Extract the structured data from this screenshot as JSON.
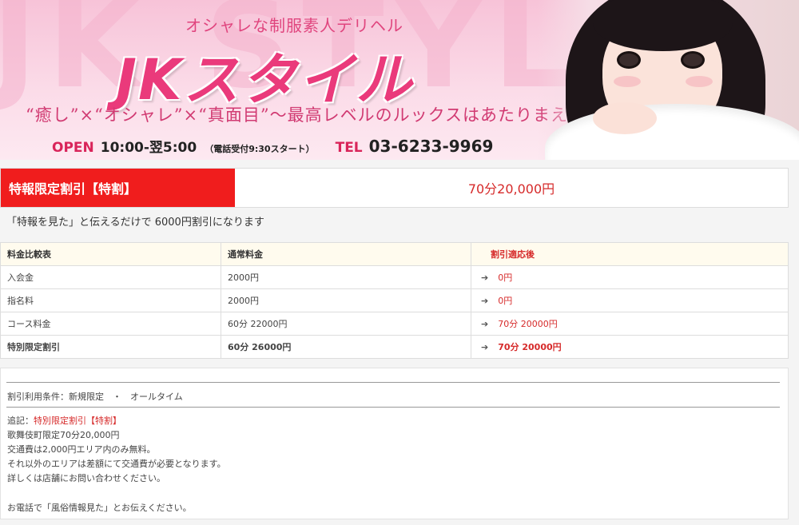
{
  "banner": {
    "bg_word": "JK STYLE",
    "tagline": "オシャレな制服素人デリヘル",
    "logo": "JKスタイル",
    "catchphrase": "“癒し”×“オシャレ”×“真面目”～最高レベルのルックスはあたりまえ～",
    "open_label": "OPEN",
    "hours": "10:00-翌5:00",
    "hours_note": "（電話受付9:30スタート）",
    "tel_label": "TEL",
    "tel_number": "03-6233-9969"
  },
  "special": {
    "title": "特報限定割引【特割】",
    "price": "70分20,000円"
  },
  "explanation": "「特報を見た」と伝えるだけで 6000円割引になります",
  "table": {
    "headers": [
      "料金比較表",
      "通常料金",
      "割引適応後"
    ],
    "rows": [
      {
        "label": "入会金",
        "normal": "2000円",
        "after": "0円"
      },
      {
        "label": "指名料",
        "normal": "2000円",
        "after": "0円"
      },
      {
        "label": "コース料金",
        "normal": "60分 22000円",
        "after": "70分 20000円"
      },
      {
        "label": "特別限定割引",
        "normal": "60分 26000円",
        "after": "70分 20000円"
      }
    ],
    "arrow_icon": "arrow-right-icon"
  },
  "conditions": {
    "usage": "割引利用条件：新規限定　・　オールタイム",
    "note_label": "追記：",
    "note_title": "特別限定割引【特割】",
    "lines": [
      "歌舞伎町限定70分20,000円",
      "交通費は2,000円エリア内のみ無料。",
      "それ以外のエリアは差額にて交通費が必要となります。",
      "詳しくは店舗にお問い合わせください。"
    ],
    "callout": "お電話で「風俗情報見た」とお伝えください。"
  },
  "colors": {
    "accent_red": "#f01d1d",
    "price_red": "#d62a2a",
    "logo_pink": "#ea3a7b",
    "banner_pink": "#f7c3d8"
  }
}
